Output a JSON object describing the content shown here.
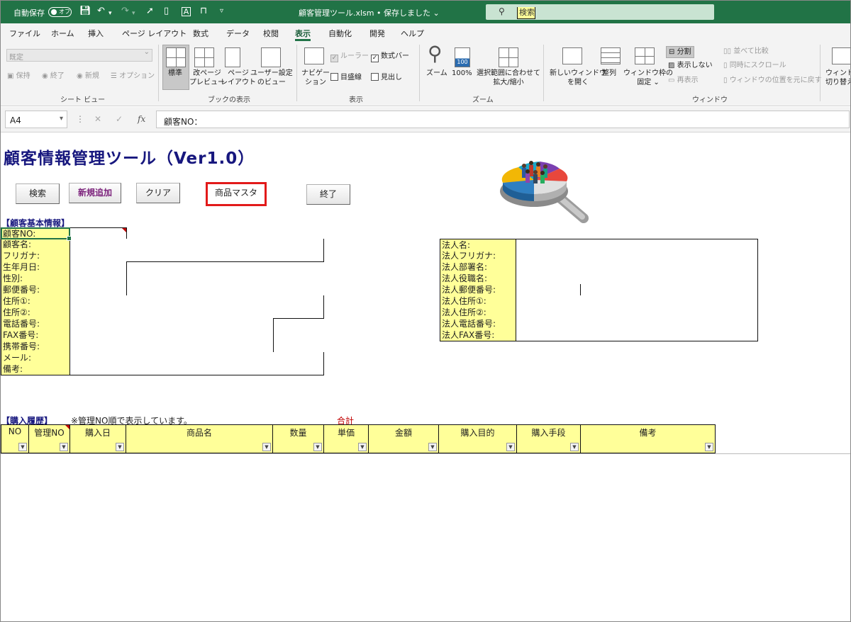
{
  "titlebar": {
    "autosave_label": "自動保存",
    "autosave_state": "オフ",
    "filename": "顧客管理ツール.xlsm • 保存しました ⌄",
    "search_placeholder": "検索"
  },
  "menu_tabs": [
    "ファイル",
    "ホーム",
    "挿入",
    "ページ レイアウト",
    "数式",
    "データ",
    "校閲",
    "表示",
    "自動化",
    "開発",
    "ヘルプ"
  ],
  "active_tab": "表示",
  "ribbon": {
    "sheetview": {
      "combo_value": "既定",
      "keep": "保持",
      "exit": "終了",
      "new": "新規",
      "options": "オプション",
      "group": "シート ビュー"
    },
    "bookview": {
      "normal": "標準",
      "pagebreak_1": "改ページ",
      "pagebreak_2": "プレビュー",
      "pagelayout_1": "ページ",
      "pagelayout_2": "レイアウト",
      "custom_1": "ユーザー設定",
      "custom_2": "のビュー",
      "group": "ブックの表示"
    },
    "show": {
      "nav_1": "ナビゲー",
      "nav_2": "ション",
      "ruler": "ルーラー",
      "formulabar": "数式バー",
      "gridlines": "目盛線",
      "headings": "見出し",
      "group": "表示"
    },
    "zoom": {
      "zoom": "ズーム",
      "hundred": "100%",
      "hundred_icon": "100",
      "sel_1": "選択範囲に合わせて",
      "sel_2": "拡大/縮小",
      "group": "ズーム"
    },
    "window": {
      "newwin_1": "新しいウィンドウ",
      "newwin_2": "を開く",
      "arrange": "整列",
      "freeze_1": "ウィンドウ枠の",
      "freeze_2": "固定 ⌄",
      "split": "分割",
      "hide": "表示しない",
      "unhide": "再表示",
      "sidebyside": "並べて比較",
      "syncscroll": "同時にスクロール",
      "resetpos": "ウィンドウの位置を元に戻す",
      "switch_1": "ウィンドウの",
      "switch_2": "切り替え",
      "group": "ウィンドウ"
    }
  },
  "formula_bar": {
    "namebox": "A4",
    "cancel": "✕",
    "enter": "✓",
    "fx": "fx",
    "content": "顧客NO："
  },
  "sheet": {
    "title": "顧客情報管理ツール（Ver1.0）",
    "buttons": {
      "search": "検索",
      "add": "新規追加",
      "clear": "クリア",
      "master": "商品マスタ",
      "exit": "終了"
    },
    "basic_section": "【顧客基本情報】",
    "basic_fields": [
      "顧客NO:",
      "顧客名:",
      "フリガナ:",
      "生年月日:",
      "性別:",
      "郵便番号:",
      "住所①:",
      "住所②:",
      "電話番号:",
      "FAX番号:",
      "携帯番号:",
      "メール:",
      "備考:"
    ],
    "corp_fields": [
      "法人名:",
      "法人フリガナ:",
      "法人部署名:",
      "法人役職名:",
      "法人郵便番号:",
      "法人住所①:",
      "法人住所②:",
      "法人電話番号:",
      "法人FAX番号:"
    ],
    "history_section": "【購入履歴】",
    "history_note": "※管理NO順で表示しています。",
    "total_label": "合計",
    "history_headers": [
      "NO",
      "管理NO",
      "購入日",
      "商品名",
      "数量",
      "単価",
      "金額",
      "購入目的",
      "購入手段",
      "備考"
    ]
  }
}
